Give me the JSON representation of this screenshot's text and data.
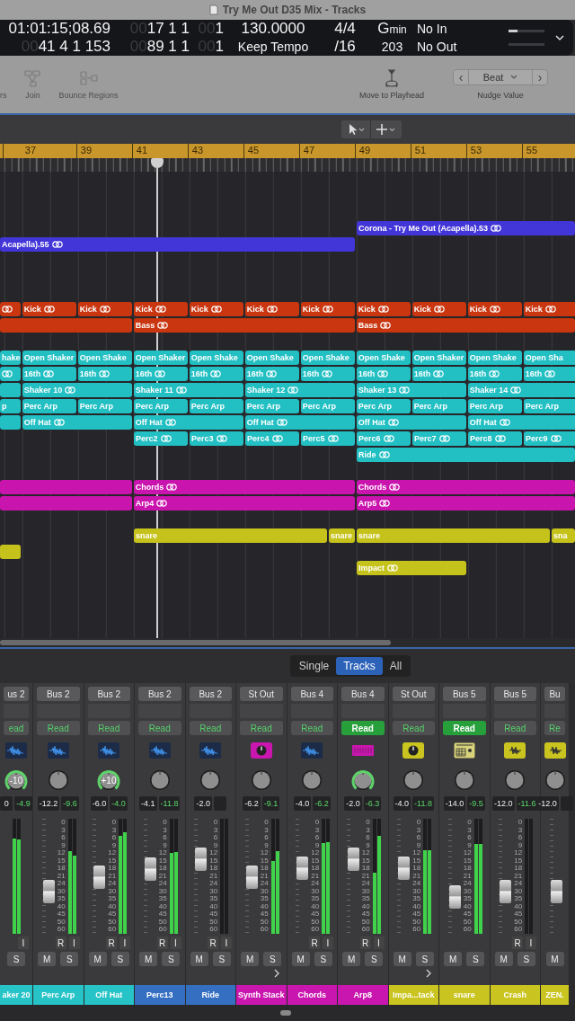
{
  "window": {
    "title": "Try Me Out D35 Mix - Tracks"
  },
  "lcd": {
    "columns": [
      {
        "kind": "clock",
        "top": {
          "text": "01:01:15;08.69"
        },
        "bottom": {
          "dim": "00",
          "text": "41 4 1 153"
        }
      },
      {
        "kind": "position",
        "top": {
          "dim": "00",
          "text": "17 1 1"
        },
        "bottom": {
          "dim": "00",
          "text": "89 1 1"
        }
      },
      {
        "kind": "division",
        "top": {
          "dim": "00",
          "text": "1"
        },
        "bottom": {
          "dim": "00",
          "text": "1"
        }
      },
      {
        "kind": "tempo",
        "top": {
          "text": "130.0000"
        },
        "bottom": {
          "text": "Keep Tempo"
        }
      },
      {
        "kind": "signature",
        "top": {
          "text": "4/4"
        },
        "bottom": {
          "text": "/16"
        }
      },
      {
        "kind": "key",
        "top": {
          "text": "G",
          "small": "min"
        },
        "bottom": {
          "text": "203"
        }
      },
      {
        "kind": "io",
        "top": {
          "text": "No In"
        },
        "bottom": {
          "text": "No Out"
        }
      }
    ],
    "load_meters": [
      {
        "level": 0.25
      },
      {
        "level": 0
      }
    ]
  },
  "toolbar": {
    "items": [
      {
        "label": "rs",
        "kind": "none",
        "disabled": true
      },
      {
        "label": "Join",
        "kind": "join",
        "disabled": true
      },
      {
        "label": "Bounce Regions",
        "kind": "bounce",
        "disabled": true
      },
      {
        "label": "Move to Playhead",
        "kind": "playhead",
        "disabled": false
      }
    ],
    "nudge": {
      "prev": "‹",
      "value": "Beat",
      "next": "›",
      "label": "Nudge Value"
    }
  },
  "tracks": {
    "ruler": [
      "37",
      "39",
      "41",
      "43",
      "45",
      "47",
      "49",
      "51",
      "53",
      "55"
    ],
    "groups": [
      {
        "lanes": [
          {
            "kind": "late",
            "color": "#4336d8",
            "regions": [
              {
                "kind": "tail",
                "label": "Corona - Try Me Out (Acapella).53",
                "loop": true
              }
            ]
          },
          {
            "kind": "edge",
            "color": "#4336d8",
            "regions": [
              {
                "kind": "leadlong",
                "label": "Acapella).55",
                "loop": true
              }
            ]
          }
        ]
      },
      {
        "lanes": [
          {
            "kind": "edge",
            "color": "#c9360f",
            "regions": [
              {
                "kind": "lead",
                "loop": true
              },
              {
                "kind": "double",
                "label": "Kick",
                "loop": true
              },
              {
                "kind": "double",
                "label": "Kick",
                "loop": true
              },
              {
                "kind": "double",
                "label": "Kick",
                "loop": true
              },
              {
                "kind": "double",
                "label": "Kick",
                "loop": true
              },
              {
                "kind": "double",
                "label": "Kick",
                "loop": true
              },
              {
                "kind": "double",
                "label": "Kick",
                "loop": true
              },
              {
                "kind": "double",
                "label": "Kick",
                "loop": true
              },
              {
                "kind": "double",
                "label": "Kick",
                "loop": true
              },
              {
                "kind": "double",
                "label": "Kick",
                "loop": true
              },
              {
                "kind": "double",
                "label": "Kick",
                "loop": true
              }
            ]
          },
          {
            "kind": "edge",
            "color": "#c9360f",
            "regions": [
              {
                "kind": "leadmid",
                "loop": false
              },
              {
                "kind": "eight",
                "label": "Bass",
                "loop": true
              },
              {
                "kind": "tail",
                "label": "Bass",
                "loop": true
              }
            ]
          }
        ]
      },
      {
        "lanes": [
          {
            "kind": "edge",
            "color": "#22bfc3",
            "regions": [
              {
                "kind": "lead",
                "label": "hake"
              },
              {
                "kind": "double",
                "label": "Open Shaker"
              },
              {
                "kind": "double",
                "label": "Open Shake"
              },
              {
                "kind": "double",
                "label": "Open Shaker"
              },
              {
                "kind": "double",
                "label": "Open Shake"
              },
              {
                "kind": "double",
                "label": "Open Shake"
              },
              {
                "kind": "double",
                "label": "Open Shake"
              },
              {
                "kind": "double",
                "label": "Open Shake"
              },
              {
                "kind": "double",
                "label": "Open Shaker"
              },
              {
                "kind": "double",
                "label": "Open Shake"
              },
              {
                "kind": "double",
                "label": "Open Sha"
              }
            ]
          },
          {
            "kind": "edge",
            "color": "#22bfc3",
            "regions": [
              {
                "kind": "lead",
                "loop": true
              },
              {
                "kind": "double",
                "label": "16th",
                "loop": true
              },
              {
                "kind": "double",
                "label": "16th",
                "loop": true
              },
              {
                "kind": "double",
                "label": "16th",
                "loop": true
              },
              {
                "kind": "double",
                "label": "16th",
                "loop": true
              },
              {
                "kind": "double",
                "label": "16th",
                "loop": true
              },
              {
                "kind": "double",
                "label": "16th",
                "loop": true
              },
              {
                "kind": "double",
                "label": "16th",
                "loop": true
              },
              {
                "kind": "double",
                "label": "16th",
                "loop": true
              },
              {
                "kind": "double",
                "label": "16th",
                "loop": true
              },
              {
                "kind": "double",
                "label": "16th",
                "loop": true
              }
            ]
          },
          {
            "kind": "edge",
            "color": "#22bfc3",
            "regions": [
              {
                "kind": "lead",
                "loop": false
              },
              {
                "kind": "quad",
                "label": "Shaker 10",
                "loop": true
              },
              {
                "kind": "quad",
                "label": "Shaker 11",
                "loop": true
              },
              {
                "kind": "quad",
                "label": "Shaker 12",
                "loop": true
              },
              {
                "kind": "quad",
                "label": "Shaker 13",
                "loop": true
              },
              {
                "kind": "quad",
                "label": "Shaker 14",
                "loop": true
              }
            ]
          },
          {
            "kind": "edge",
            "color": "#22bfc3",
            "regions": [
              {
                "kind": "lead",
                "label": "p"
              },
              {
                "kind": "double",
                "label": "Perc Arp",
                "loop": false
              },
              {
                "kind": "double",
                "label": "Perc Arp",
                "loop": false
              },
              {
                "kind": "double",
                "label": "Perc Arp",
                "loop": false
              },
              {
                "kind": "double",
                "label": "Perc Arp",
                "loop": false
              },
              {
                "kind": "double",
                "label": "Perc Arp",
                "loop": false
              },
              {
                "kind": "double",
                "label": "Perc Arp",
                "loop": false
              },
              {
                "kind": "double",
                "label": "Perc Arp",
                "loop": false
              },
              {
                "kind": "double",
                "label": "Perc Arp",
                "loop": false
              },
              {
                "kind": "double",
                "label": "Perc Arp",
                "loop": false
              },
              {
                "kind": "double",
                "label": "Perc Arp",
                "loop": false
              }
            ]
          },
          {
            "kind": "edge",
            "color": "#22bfc3",
            "regions": [
              {
                "kind": "lead",
                "loop": false
              },
              {
                "kind": "quad",
                "label": "Off Hat",
                "loop": true
              },
              {
                "kind": "quad",
                "label": "Off Hat",
                "loop": true
              },
              {
                "kind": "quad",
                "label": "Off Hat",
                "loop": true
              },
              {
                "kind": "quad",
                "label": "Off Hat",
                "loop": true
              },
              {
                "kind": "quad",
                "label": "Off Hat",
                "loop": true
              }
            ]
          },
          {
            "kind": "mid",
            "color": "#22bfc3",
            "regions": [
              {
                "kind": "double",
                "label": "Perc2",
                "loop": true
              },
              {
                "kind": "double",
                "label": "Perc3",
                "loop": true
              },
              {
                "kind": "double",
                "label": "Perc4",
                "loop": true
              },
              {
                "kind": "double",
                "label": "Perc5",
                "loop": true
              },
              {
                "kind": "double",
                "label": "Perc6",
                "loop": true
              },
              {
                "kind": "double",
                "label": "Perc7",
                "loop": true
              },
              {
                "kind": "double",
                "label": "Perc8",
                "loop": true
              },
              {
                "kind": "double",
                "label": "Perc9",
                "loop": true
              }
            ]
          },
          {
            "kind": "late",
            "color": "#22bfc3",
            "regions": [
              {
                "kind": "tail",
                "label": "Ride",
                "loop": true
              }
            ]
          }
        ]
      },
      {
        "lanes": [
          {
            "kind": "edge",
            "color": "#c914ad",
            "regions": [
              {
                "kind": "leadmid",
                "loop": false
              },
              {
                "kind": "eight",
                "label": "Chords",
                "loop": true
              },
              {
                "kind": "tail",
                "label": "Chords",
                "loop": true
              }
            ]
          },
          {
            "kind": "edge",
            "color": "#c914ad",
            "regions": [
              {
                "kind": "leadmid",
                "loop": false
              },
              {
                "kind": "eight",
                "label": "Arp4",
                "loop": true
              },
              {
                "kind": "tail",
                "label": "Arp5",
                "loop": true
              }
            ]
          }
        ]
      },
      {
        "lanes": [
          {
            "kind": "mid",
            "color": "#c6c21c",
            "regions": [
              {
                "kind": "seven",
                "label": "snare",
                "loop": false
              },
              {
                "kind": "single",
                "label": "snare"
              },
              {
                "kind": "seven",
                "label": "snare",
                "loop": false
              },
              {
                "kind": "tail",
                "label": "sna"
              }
            ]
          },
          {
            "kind": "edge",
            "color": "#c6c21c",
            "regions": [
              {
                "kind": "lead",
                "loop": false
              }
            ]
          },
          {
            "kind": "late",
            "color": "#c6c21c",
            "regions": [
              {
                "kind": "quad",
                "label": "Impact",
                "loop": true
              }
            ]
          }
        ]
      }
    ]
  },
  "mixer": {
    "views": [
      {
        "label": "Single",
        "selected": false
      },
      {
        "label": "Tracks",
        "selected": true
      },
      {
        "label": "All",
        "selected": false
      }
    ],
    "strips": [
      {
        "output": "us 2",
        "automation": {
          "label": "ead",
          "on": false
        },
        "kind": "audio",
        "pan": {
          "active": true,
          "label": "-10"
        },
        "readouts": [
          "0",
          "-4.9"
        ],
        "meters": [
          {
            "level": 0.83
          },
          {
            "level": 0.82
          }
        ],
        "input_label": "I",
        "solo_label": "S",
        "stack_arrow": false,
        "name": "aker 20",
        "color": "#26c3c7"
      },
      {
        "output": "Bus 2",
        "automation": {
          "label": "Read",
          "on": false
        },
        "kind": "audio",
        "pan": {
          "active": false
        },
        "readouts": [
          "-12.2",
          "-9.6"
        ],
        "scale": [
          "0",
          "3",
          "6",
          "9",
          "12",
          "15",
          "18",
          "21",
          "24",
          "30",
          "35",
          "40",
          "45",
          "50",
          "60"
        ],
        "fader": {
          "level": 0.37
        },
        "meters": [
          {
            "level": 0.72
          },
          {
            "level": 0.68
          }
        ],
        "record_label": "R",
        "input_label": "I",
        "mute_label": "M",
        "solo_label": "S",
        "stack_arrow": false,
        "name": "Perc Arp",
        "color": "#26c3c7"
      },
      {
        "output": "Bus 2",
        "automation": {
          "label": "Read",
          "on": false
        },
        "kind": "audio",
        "pan": {
          "active": true,
          "label": "+10"
        },
        "readouts": [
          "-6.0",
          "-4.0"
        ],
        "scale": [
          "0",
          "3",
          "6",
          "9",
          "12",
          "15",
          "18",
          "21",
          "24",
          "30",
          "35",
          "40",
          "45",
          "50",
          "60"
        ],
        "fader": {
          "level": 0.49
        },
        "meters": [
          {
            "level": 0.85
          },
          {
            "level": 0.88
          }
        ],
        "record_label": "R",
        "input_label": "I",
        "mute_label": "M",
        "solo_label": "S",
        "stack_arrow": false,
        "name": "Off Hat",
        "color": "#26c3c7"
      },
      {
        "output": "Bus 2",
        "automation": {
          "label": "Read",
          "on": false
        },
        "kind": "audio",
        "pan": {
          "active": false
        },
        "readouts": [
          "-4.1",
          "-11.8"
        ],
        "scale": [
          "0",
          "3",
          "6",
          "9",
          "12",
          "15",
          "18",
          "21",
          "24",
          "30",
          "35",
          "40",
          "45",
          "50",
          "60"
        ],
        "fader": {
          "level": 0.56
        },
        "meters": [
          {
            "level": 0.7
          },
          {
            "level": 0.71
          }
        ],
        "record_label": "R",
        "input_label": "I",
        "mute_label": "M",
        "solo_label": "S",
        "stack_arrow": false,
        "name": "Perc13",
        "color": "#356fc2"
      },
      {
        "output": "Bus 2",
        "automation": {
          "label": "Read",
          "on": false
        },
        "kind": "audio",
        "pan": {
          "active": false
        },
        "readouts": [
          "-2.0"
        ],
        "scale": [
          "0",
          "3",
          "6",
          "9",
          "12",
          "15",
          "18",
          "21",
          "24",
          "30",
          "35",
          "40",
          "45",
          "50",
          "60"
        ],
        "fader": {
          "level": 0.65
        },
        "meters": [
          {
            "level": 0
          },
          {
            "level": 0
          }
        ],
        "record_label": "R",
        "input_label": "I",
        "mute_label": "M",
        "solo_label": "S",
        "stack_arrow": false,
        "name": "Ride",
        "color": "#356fc2"
      },
      {
        "output": "St Out",
        "automation": {
          "label": "Read",
          "on": false
        },
        "kind": "synth",
        "pan": {
          "active": false
        },
        "readouts": [
          "-6.2",
          "-9.1"
        ],
        "scale": [
          "0",
          "3",
          "6",
          "9",
          "12",
          "15",
          "18",
          "21",
          "24",
          "30",
          "35",
          "40",
          "45",
          "50",
          "60"
        ],
        "fader": {
          "level": 0.49
        },
        "meters": [
          {
            "level": 0.63
          },
          {
            "level": 0.72
          }
        ],
        "mute_label": "M",
        "solo_label": "S",
        "stack_arrow": true,
        "name": "Synth Stack",
        "color": "#c916ae"
      },
      {
        "output": "Bus 4",
        "automation": {
          "label": "Read",
          "on": false
        },
        "kind": "audio",
        "pan": {
          "active": false
        },
        "readouts": [
          "-4.0",
          "-6.2"
        ],
        "scale": [
          "0",
          "3",
          "6",
          "9",
          "12",
          "15",
          "18",
          "21",
          "24",
          "30",
          "35",
          "40",
          "45",
          "50",
          "60"
        ],
        "fader": {
          "level": 0.57
        },
        "meters": [
          {
            "level": 0.79
          },
          {
            "level": 0.8
          }
        ],
        "record_label": "R",
        "input_label": "I",
        "mute_label": "M",
        "solo_label": "S",
        "stack_arrow": false,
        "name": "Chords",
        "color": "#c916ae"
      },
      {
        "output": "Bus 4",
        "automation": {
          "label": "Read",
          "on": true
        },
        "kind": "keys",
        "pan": {
          "active": true
        },
        "readouts": [
          "-2.0",
          "-6.3"
        ],
        "scale": [
          "0",
          "3",
          "6",
          "9",
          "12",
          "15",
          "18",
          "21",
          "24",
          "30",
          "35",
          "40",
          "45",
          "50",
          "60"
        ],
        "fader": {
          "level": 0.65
        },
        "meters": [
          {
            "level": 0.53
          },
          {
            "level": 0.85
          }
        ],
        "record_label": "R",
        "input_label": "I",
        "mute_label": "M",
        "solo_label": "S",
        "stack_arrow": false,
        "name": "Arp8",
        "color": "#c916ae"
      },
      {
        "output": "St Out",
        "automation": {
          "label": "Read",
          "on": false
        },
        "kind": "synth",
        "pan": {
          "active": false
        },
        "readouts": [
          "-4.0",
          "-11.8"
        ],
        "scale": [
          "0",
          "3",
          "6",
          "9",
          "12",
          "15",
          "18",
          "21",
          "24",
          "30",
          "35",
          "40",
          "45",
          "50",
          "60"
        ],
        "fader": {
          "level": 0.57
        },
        "meters": [
          {
            "level": 0.73
          },
          {
            "level": 0.73
          }
        ],
        "mute_label": "M",
        "solo_label": "S",
        "stack_arrow": true,
        "name": "Impa...tack",
        "color": "#c9c41f"
      },
      {
        "output": "Bus 5",
        "automation": {
          "label": "Read",
          "on": true
        },
        "kind": "drum",
        "pan": {
          "active": false
        },
        "readouts": [
          "-14.0",
          "-9.5"
        ],
        "scale": [
          "0",
          "3",
          "6",
          "9",
          "12",
          "15",
          "18",
          "21",
          "24",
          "30",
          "35",
          "40",
          "45",
          "50",
          "60"
        ],
        "fader": {
          "level": 0.32
        },
        "meters": [
          {
            "level": 0.78
          },
          {
            "level": 0.78
          }
        ],
        "mute_label": "M",
        "solo_label": "S",
        "stack_arrow": false,
        "name": "snare",
        "color": "#c9c41f"
      },
      {
        "output": "Bus 5",
        "automation": {
          "label": "Read",
          "on": false
        },
        "kind": "sampler",
        "pan": {
          "active": false
        },
        "readouts": [
          "-12.0",
          "-11.6"
        ],
        "scale": [
          "0",
          "3",
          "6",
          "9",
          "12",
          "15",
          "18",
          "21",
          "24",
          "30",
          "35",
          "40",
          "45",
          "50",
          "60"
        ],
        "fader": {
          "level": 0.37
        },
        "meters": [
          {
            "level": 0
          },
          {
            "level": 0
          }
        ],
        "record_label": "R",
        "input_label": "I",
        "mute_label": "M",
        "solo_label": "S",
        "stack_arrow": false,
        "name": "Crash",
        "color": "#c9c41f"
      },
      {
        "output": "Bu",
        "automation": {
          "label": "Re",
          "on": false
        },
        "kind": "sampler",
        "pan": {
          "active": false
        },
        "readouts": [
          "-12.0"
        ],
        "fader": {
          "level": 0.37
        },
        "mute_label": "M",
        "stack_arrow": false,
        "name": "ZEN.",
        "color": "#c9c41f"
      }
    ]
  }
}
